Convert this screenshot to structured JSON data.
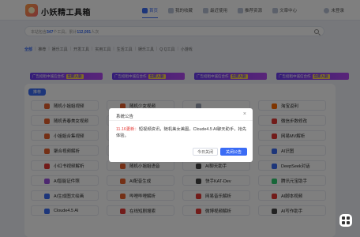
{
  "header": {
    "site_title": "小妖精工具箱",
    "nav": [
      {
        "label": "首页",
        "icon": "home-icon",
        "active": true
      },
      {
        "label": "我的收藏",
        "icon": "heart-icon",
        "active": false
      },
      {
        "label": "最近使用",
        "icon": "clock-icon",
        "active": false
      },
      {
        "label": "推荐资源",
        "icon": "thumbs-up-icon",
        "active": false
      },
      {
        "label": "文章中心",
        "icon": "document-icon",
        "active": false
      }
    ],
    "login_label": "未登录"
  },
  "search": {
    "prefix": "本站包含",
    "count_tools": "347",
    "middle": "个工具，累计",
    "count_uses": "112,091",
    "suffix": "人次"
  },
  "categories": [
    "全部",
    "推荐",
    "娱乐工具",
    "开发工具",
    "实用工具",
    "生活工具",
    "娱乐工具",
    "Q Q工具",
    "小游戏"
  ],
  "banners": [
    {
      "text": "广告招租中诚信合作",
      "tag": "立即入驻"
    },
    {
      "text": "广告招租中诚信合作",
      "tag": "立即入驻"
    },
    {
      "text": "广告招租中诚信合作",
      "tag": "立即入驻"
    },
    {
      "text": "广告招租中诚信合作",
      "tag": "立即入驻"
    }
  ],
  "recommend_label": "推荐",
  "tools": [
    {
      "label": "随机小姐姐视频",
      "color": "#e8612c",
      "icon": "play-icon"
    },
    {
      "label": "随机少女视频",
      "color": "#e8612c",
      "icon": "play-icon"
    },
    {
      "label": "",
      "color": "#9aa3b5",
      "icon": "blank-icon"
    },
    {
      "label": "淘宝返利",
      "color": "#ff6a00",
      "icon": "taobao-icon"
    },
    {
      "label": "随机青春美女视频",
      "color": "#e8612c",
      "icon": "play-icon"
    },
    {
      "label": "",
      "color": "#9aa3b5",
      "icon": "blank-icon"
    },
    {
      "label": "",
      "color": "#9aa3b5",
      "icon": "blank-icon"
    },
    {
      "label": "微信步数修改",
      "color": "#e53935",
      "icon": "walk-icon"
    },
    {
      "label": "小姐姐合集视频",
      "color": "#e8612c",
      "icon": "play-icon"
    },
    {
      "label": "",
      "color": "#9aa3b5",
      "icon": "blank-icon"
    },
    {
      "label": "",
      "color": "#9aa3b5",
      "icon": "blank-icon"
    },
    {
      "label": "网易MV解析",
      "color": "#e53935",
      "icon": "music-icon"
    },
    {
      "label": "聚合视频解析",
      "color": "#e8612c",
      "icon": "play-icon"
    },
    {
      "label": "网易云音乐解析",
      "color": "#e53935",
      "icon": "music-icon"
    },
    {
      "label": "AI文生图",
      "color": "#444444",
      "icon": "ai-icon"
    },
    {
      "label": "AI识图",
      "color": "#3b6cf5",
      "icon": "eye-icon"
    },
    {
      "label": "小红书视频解析",
      "color": "#e53935",
      "icon": "book-icon"
    },
    {
      "label": "随机小姐姐语音",
      "color": "#e8612c",
      "icon": "mic-icon"
    },
    {
      "label": "AI聊天助手",
      "color": "#444444",
      "icon": "chat-icon"
    },
    {
      "label": "DeepSeek对话",
      "color": "#3b6cf5",
      "icon": "whale-icon"
    },
    {
      "label": "AI智能证件照",
      "color": "#9b51e0",
      "icon": "id-icon"
    },
    {
      "label": "AI配音生成",
      "color": "#e8612c",
      "icon": "speaker-icon"
    },
    {
      "label": "快手KAT-Dev",
      "color": "#444444",
      "icon": "code-icon"
    },
    {
      "label": "腾讯元宝助手",
      "color": "#2ecc71",
      "icon": "yuanbao-icon"
    },
    {
      "label": "AI生成图文绘画",
      "color": "#3b6cf5",
      "icon": "paint-icon"
    },
    {
      "label": "哔哩哔哩解析",
      "color": "#e8612c",
      "icon": "bilibili-icon"
    },
    {
      "label": "网易音乐解析",
      "color": "#e53935",
      "icon": "music-icon"
    },
    {
      "label": "AI脚本视频",
      "color": "#e53935",
      "icon": "film-icon"
    },
    {
      "label": "Cloude4.5 AI",
      "color": "#3b6cf5",
      "icon": "claude-icon"
    },
    {
      "label": "在线短剧搜索",
      "color": "#e53935",
      "icon": "video-icon"
    },
    {
      "label": "微博视频解析",
      "color": "#e53935",
      "icon": "weibo-icon"
    },
    {
      "label": "AI写作助手",
      "color": "#444444",
      "icon": "pen-icon"
    }
  ],
  "dialog": {
    "title": "系统公告",
    "close_glyph": "×",
    "date": "11.16更新：",
    "body": "短视频资讯，随机美女美图，Cloude4.5 AI聊天助手，抢先体验。",
    "btn_later": "今日关闭",
    "btn_close": "关闭公告"
  },
  "colors": {
    "accent": "#3b6cf5",
    "overlay": "rgba(0,0,0,0.5)"
  }
}
